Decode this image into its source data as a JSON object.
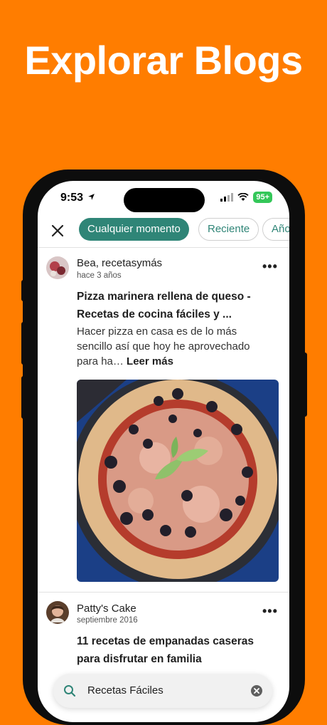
{
  "promo": {
    "headline": "Explorar Blogs",
    "background": "#FF7D00"
  },
  "status_bar": {
    "time": "9:53",
    "battery": "95+"
  },
  "filters": {
    "chips": [
      {
        "label": "Cualquier momento",
        "active": true
      },
      {
        "label": "Reciente",
        "active": false
      },
      {
        "label": "Año",
        "active": false
      }
    ],
    "accent": "#2F8577"
  },
  "posts": [
    {
      "author": "Bea, recetasymás",
      "date": "hace 3 años",
      "title_line1": "Pizza marinera rellena de queso -",
      "title_line2": "Recetas de cocina fáciles y ...",
      "excerpt_line1": "Hacer pizza en casa es de lo más",
      "excerpt_line2": "sencillo así que hoy he aprovechado",
      "excerpt_line3": "para ha…",
      "read_more": "Leer más",
      "image": "pizza-photo"
    },
    {
      "author": "Patty's Cake",
      "date": "septiembre 2016",
      "title_line1": "11 recetas de empanadas caseras",
      "title_line2": "para disfrutar en familia"
    }
  ],
  "search": {
    "query": "Recetas Fáciles"
  }
}
